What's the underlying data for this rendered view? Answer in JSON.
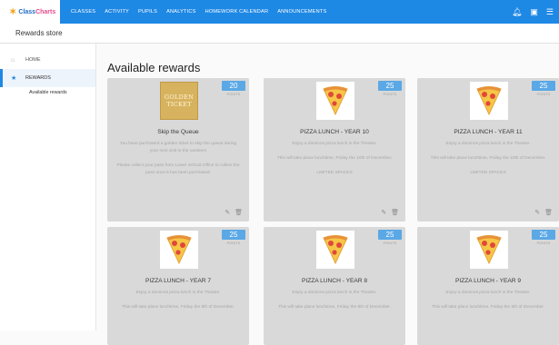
{
  "app": {
    "logo_name": "ClassCharts",
    "logo_first": "Class",
    "logo_second": "Charts"
  },
  "nav": [
    "CLASSES",
    "ACTIVITY",
    "PUPILS",
    "ANALYTICS",
    "HOMEWORK CALENDAR",
    "ANNOUNCEMENTS"
  ],
  "top_icons": [
    "bell-icon",
    "user-profile-icon",
    "menu-icon"
  ],
  "subheader": {
    "title": "Rewards store"
  },
  "sidebar": {
    "home": "HOME",
    "rewards": "REWARDS",
    "sub": "Available rewards"
  },
  "main": {
    "heading": "Available rewards"
  },
  "cards": [
    {
      "title": "Skip the Queue",
      "points": "20",
      "points_label": "POINTS",
      "image": "golden-ticket",
      "image_text": [
        "GOLDEN",
        "TICKET"
      ],
      "desc": [
        "You have purchased a golden ticket to skip the queue during your next visit to the canteen!",
        "Please collect your pass from Lower School Office to collect the pass once it has been purchased."
      ]
    },
    {
      "title": "PIZZA LUNCH - YEAR 10",
      "points": "25",
      "points_label": "POINTS",
      "image": "pizza",
      "desc": [
        "Enjoy a dominos pizza lunch in the Theatre.",
        "This will take place lunchtime, Friday the 10th of December.",
        "LIMITED SPACES"
      ]
    },
    {
      "title": "PIZZA LUNCH - YEAR 11",
      "points": "25",
      "points_label": "POINTS",
      "image": "pizza",
      "desc": [
        "Enjoy a dominos pizza lunch in the Theatre.",
        "This will take place lunchtime, Friday the 10th of December.",
        "LIMITED SPACES"
      ]
    },
    {
      "title": "PIZZA LUNCH - YEAR 7",
      "points": "25",
      "points_label": "POINTS",
      "image": "pizza",
      "desc": [
        "Enjoy a dominos pizza lunch in the Theatre.",
        "This will take place lunchtime, Friday the 8th of December."
      ]
    },
    {
      "title": "PIZZA LUNCH - YEAR 8",
      "points": "25",
      "points_label": "POINTS",
      "image": "pizza",
      "desc": [
        "Enjoy a dominos pizza lunch in the Theatre.",
        "This will take place lunchtime, Friday the 8th of December."
      ]
    },
    {
      "title": "PIZZA LUNCH - YEAR 9",
      "points": "25",
      "points_label": "POINTS",
      "image": "pizza",
      "desc": [
        "Enjoy a dominos pizza lunch in the Theatre.",
        "This will take place lunchtime, Friday the 8th of December."
      ]
    }
  ],
  "colors": {
    "topbar": "#1e88e5",
    "badge": "#5aa8e6",
    "card": "#d9d9d9"
  }
}
